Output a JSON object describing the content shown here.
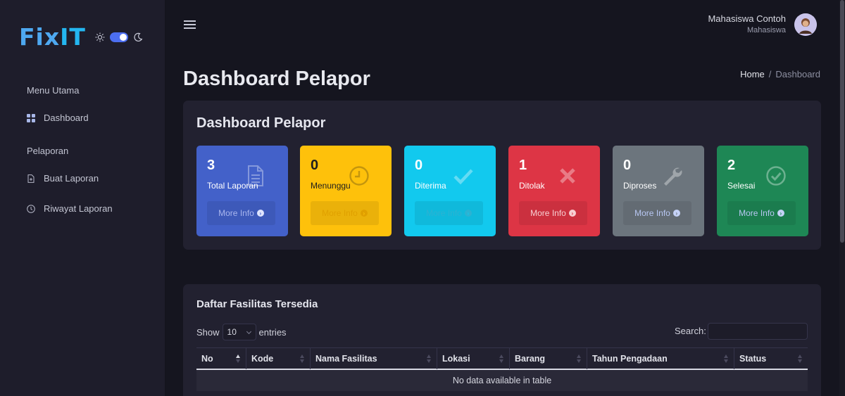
{
  "brand": {
    "part1": "Fix",
    "part2": "IT"
  },
  "sidebar": {
    "sections": [
      {
        "label": "Menu Utama"
      },
      {
        "label": "Pelaporan"
      }
    ],
    "items": [
      {
        "label": "Dashboard",
        "icon": "grid-icon"
      },
      {
        "label": "Buat Laporan",
        "icon": "file-plus-icon"
      },
      {
        "label": "Riwayat Laporan",
        "icon": "clock-icon"
      }
    ]
  },
  "header": {
    "user_name": "Mahasiswa Contoh",
    "user_role": "Mahasiswa"
  },
  "page": {
    "title": "Dashboard Pelapor",
    "breadcrumb": {
      "home": "Home",
      "separator": "/",
      "current": "Dashboard"
    }
  },
  "stats_panel": {
    "title": "Dashboard Pelapor",
    "cards": [
      {
        "value": "3",
        "label": "Total Laporan",
        "more": "More Info",
        "color": "#4361c9",
        "icon": "document-icon"
      },
      {
        "value": "0",
        "label": "Menunggu",
        "more": "More Info",
        "color": "#fec10b",
        "icon": "clock-icon"
      },
      {
        "value": "0",
        "label": "Diterima",
        "more": "More Info",
        "color": "#12c9ee",
        "icon": "check-icon"
      },
      {
        "value": "1",
        "label": "Ditolak",
        "more": "More Info",
        "color": "#dd3545",
        "icon": "x-icon"
      },
      {
        "value": "0",
        "label": "Diproses",
        "more": "More Info",
        "color": "#6c757d",
        "icon": "wrench-icon"
      },
      {
        "value": "2",
        "label": "Selesai",
        "more": "More Info",
        "color": "#1e8755",
        "icon": "check-circle-icon"
      }
    ]
  },
  "table_panel": {
    "title": "Daftar Fasilitas Tersedia",
    "show_label": "Show",
    "entries_value": "10",
    "entries_label": "entries",
    "search_label": "Search:",
    "search_value": "",
    "columns": [
      "No",
      "Kode",
      "Nama Fasilitas",
      "Lokasi",
      "Barang",
      "Tahun Pengadaan",
      "Status"
    ],
    "empty_message": "No data available in table"
  }
}
